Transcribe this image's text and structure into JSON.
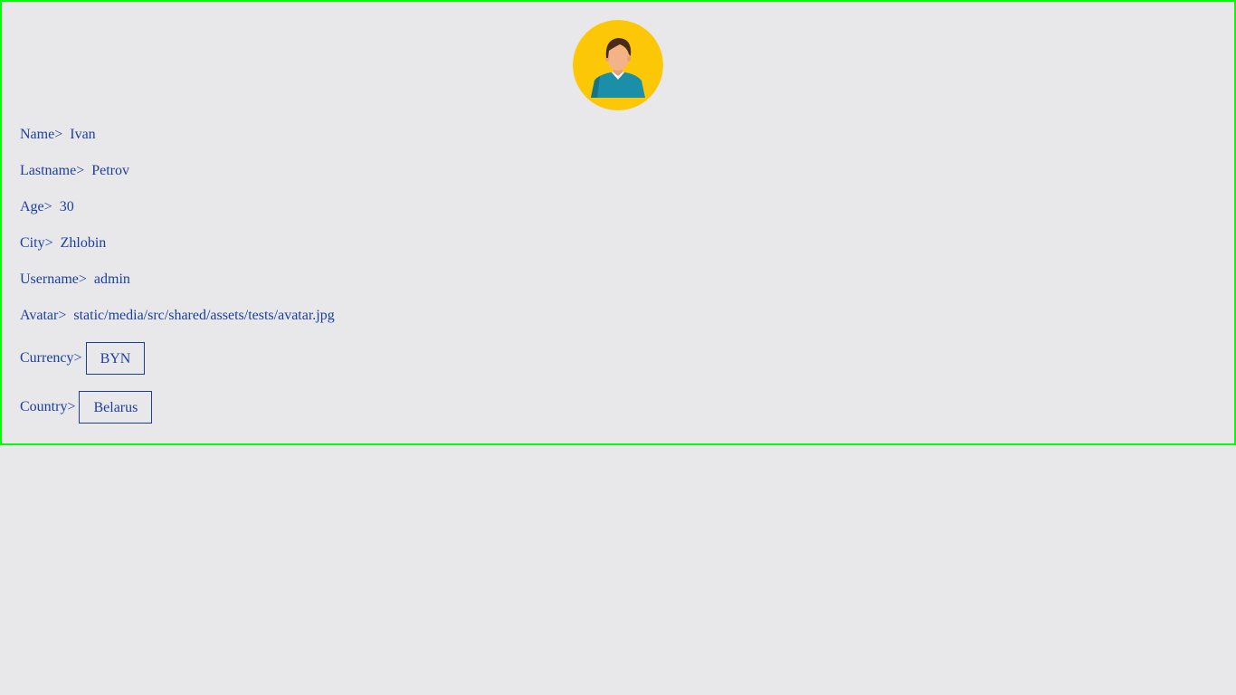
{
  "profile": {
    "avatar_alt": "avatar",
    "fields": {
      "name": {
        "label": "Name>",
        "value": "Ivan"
      },
      "lastname": {
        "label": "Lastname>",
        "value": "Petrov"
      },
      "age": {
        "label": "Age>",
        "value": "30"
      },
      "city": {
        "label": "City>",
        "value": "Zhlobin"
      },
      "username": {
        "label": "Username>",
        "value": "admin"
      },
      "avatar": {
        "label": "Avatar>",
        "value": "static/media/src/shared/assets/tests/avatar.jpg"
      }
    },
    "currency": {
      "label": "Currency>",
      "value": "BYN"
    },
    "country": {
      "label": "Country>",
      "value": "Belarus"
    }
  },
  "colors": {
    "text": "#1c3f9e",
    "card_border": "#00ff00",
    "background": "#e8e8ea",
    "avatar_background": "#fcc707"
  }
}
